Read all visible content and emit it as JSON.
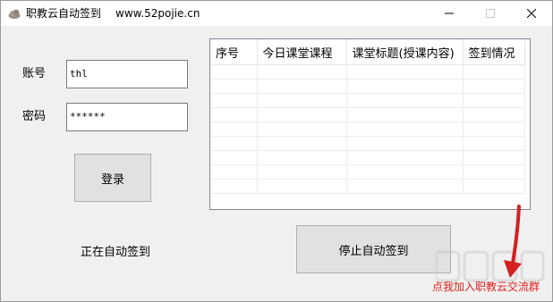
{
  "window": {
    "title": "职教云自动签到",
    "url": "www.52pojie.cn",
    "icon": "cloud-app-icon"
  },
  "login": {
    "account_label": "账号",
    "account_value": "thl",
    "password_label": "密码",
    "password_value": "******",
    "login_button": "登录"
  },
  "status": {
    "text": "正在自动签到"
  },
  "table": {
    "headers": [
      "序号",
      "今日课堂课程",
      "课堂标题(授课内容)",
      "签到情况"
    ],
    "empty_rows": 9
  },
  "actions": {
    "stop_button": "停止自动签到"
  },
  "footer": {
    "join_link": "点我加入职教云交流群",
    "link_color": "#e0201b"
  },
  "colors": {
    "window_bg": "#f0f0f0",
    "titlebar_bg": "#ffffff",
    "button_bg": "#e1e1e1",
    "annotation_arrow": "#d42020"
  }
}
